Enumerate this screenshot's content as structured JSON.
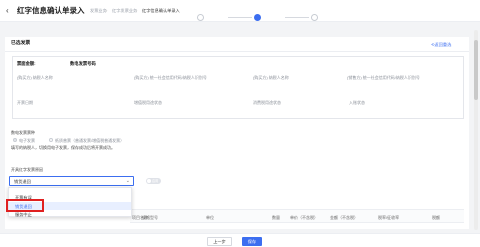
{
  "header": {
    "back_icon": "‹",
    "title": "红字信息确认单录入",
    "breadcrumbs": [
      "发票业务",
      "红字发票业务",
      "红字信息确认单录入"
    ]
  },
  "steps": [
    {
      "label": "",
      "active": false
    },
    {
      "label": "",
      "active": true
    },
    {
      "label": "",
      "active": false
    }
  ],
  "invoice_section": {
    "title": "已选发票",
    "reselect_link": "⟲返回重选",
    "amount_label": "票面金额:",
    "invoice_no_label": "数电发票号码",
    "buyer_name": "(购买方) 纳税人名称",
    "buyer_id": "(购买方) 统一社会信用代码/纳税人识别号",
    "seller_name": "(购买方) 纳税人名称",
    "seller_id": "(销售方) 统一社会信用代码/纳税人识别号",
    "issue_date": "开票日期",
    "vat_status": "增值税用途状态",
    "consumption_status": "消费税用途状态",
    "entry_status": "入账状态"
  },
  "invoice_type": {
    "label": "数电发票票种",
    "option1": "电子发票",
    "option2": "纸质普票（普通发票/增值税普通发票）",
    "hint": "填写的纳税人，切换用电子发票，保存成功后将开票成功。"
  },
  "reason": {
    "label": "开具红字发票原因",
    "selected": "销货退回",
    "arrow_icon": "⌄",
    "toggle_label": "启用",
    "options": [
      "开票有误",
      "销货退回",
      "服务中止"
    ]
  },
  "table": {
    "headers": [
      "项目名称",
      "规格型号",
      "单位",
      "数量",
      "单价（不含税）",
      "金额（不含税）",
      "税率/征收率",
      "税额"
    ]
  },
  "footer": {
    "prev_label": "上一步",
    "save_label": "保存"
  },
  "colors": {
    "accent": "#3c6ef0",
    "highlight": "#e02020"
  }
}
